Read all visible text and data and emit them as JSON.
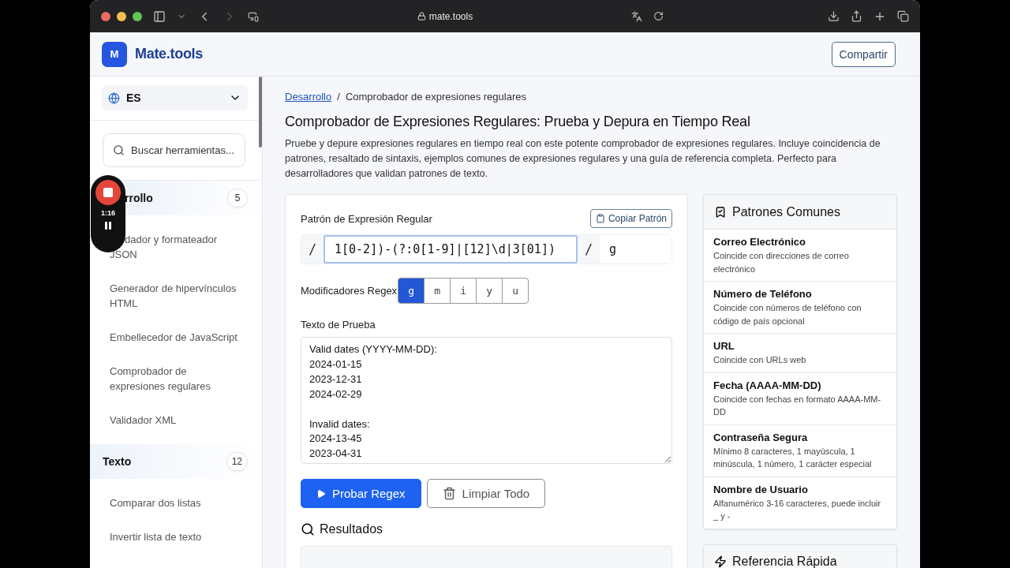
{
  "browser": {
    "url": "mate.tools"
  },
  "header": {
    "logo_letter": "M",
    "brand": "Mate.tools",
    "share": "Compartir"
  },
  "sidebar": {
    "language": "ES",
    "search_placeholder": "Buscar herramientas...",
    "groups": [
      {
        "label": "rrollo",
        "count": "5",
        "items": [
          "dador y formateador JSON",
          "Generador de hipervínculos HTML",
          "Embellecedor de JavaScript",
          "Comprobador de expresiones regulares",
          "Validador XML"
        ]
      },
      {
        "label": "Texto",
        "count": "12",
        "items": [
          "Comparar dos listas",
          "Invertir lista de texto"
        ]
      }
    ]
  },
  "recorder": {
    "time": "1:16"
  },
  "breadcrumb": [
    {
      "label": "Desarrollo",
      "kind": "link"
    },
    {
      "label": "/",
      "kind": "separator"
    },
    {
      "label": "Comprobador de expresiones regulares",
      "kind": "current"
    }
  ],
  "title": "Comprobador de Expresiones Regulares: Prueba y Depura en Tiempo Real",
  "description": "Pruebe y depure expresiones regulares en tiempo real con este potente comprobador de expresiones regulares. Incluye coincidencia de patrones, resaltado de sintaxis, ejemplos comunes de expresiones regulares y una guía de referencia completa. Perfecto para desarrolladores que validan patrones de texto.",
  "pattern": {
    "label": "Patrón de Expresión Regular",
    "copy": "Copiar Patrón",
    "open": "/",
    "value": "1[0-2])-(?:0[1-9]|[12]\\d|3[01])",
    "close": "/",
    "flags_value": "g"
  },
  "modifiers": {
    "label": "Modificadores Regex",
    "flags": [
      {
        "label": "g",
        "selected": true
      },
      {
        "label": "m",
        "selected": false
      },
      {
        "label": "i",
        "selected": false
      },
      {
        "label": "y",
        "selected": false
      },
      {
        "label": "u",
        "selected": false
      }
    ]
  },
  "test_text": {
    "label": "Texto de Prueba",
    "value": "Valid dates (YYYY-MM-DD):\n2024-01-15\n2023-12-31\n2024-02-29\n\nInvalid dates:\n2024-13-45\n2023-04-31"
  },
  "actions": [
    {
      "label": "Probar Regex",
      "kind": "primary"
    },
    {
      "label": "Limpiar Todo",
      "kind": "secondary"
    }
  ],
  "results": {
    "title": "Resultados"
  },
  "common_patterns": {
    "title": "Patrones Comunes",
    "items": [
      {
        "name": "Correo Electrónico",
        "description": "Coincide con direcciones de correo electrónico"
      },
      {
        "name": "Número de Teléfono",
        "description": "Coincide con números de teléfono con código de país opcional"
      },
      {
        "name": "URL",
        "description": "Coincide con URLs web"
      },
      {
        "name": "Fecha (AAAA-MM-DD)",
        "description": "Coincide con fechas en formato AAAA-MM-DD"
      },
      {
        "name": "Contraseña Segura",
        "description": "Mínimo 8 caracteres, 1 mayúscula, 1 minúscula, 1 número, 1 carácter especial"
      },
      {
        "name": "Nombre de Usuario",
        "description": "Alfanumérico 3-16 caracteres, puede incluir _ y -"
      }
    ]
  },
  "quick_reference": {
    "title": "Referencia Rápida"
  }
}
